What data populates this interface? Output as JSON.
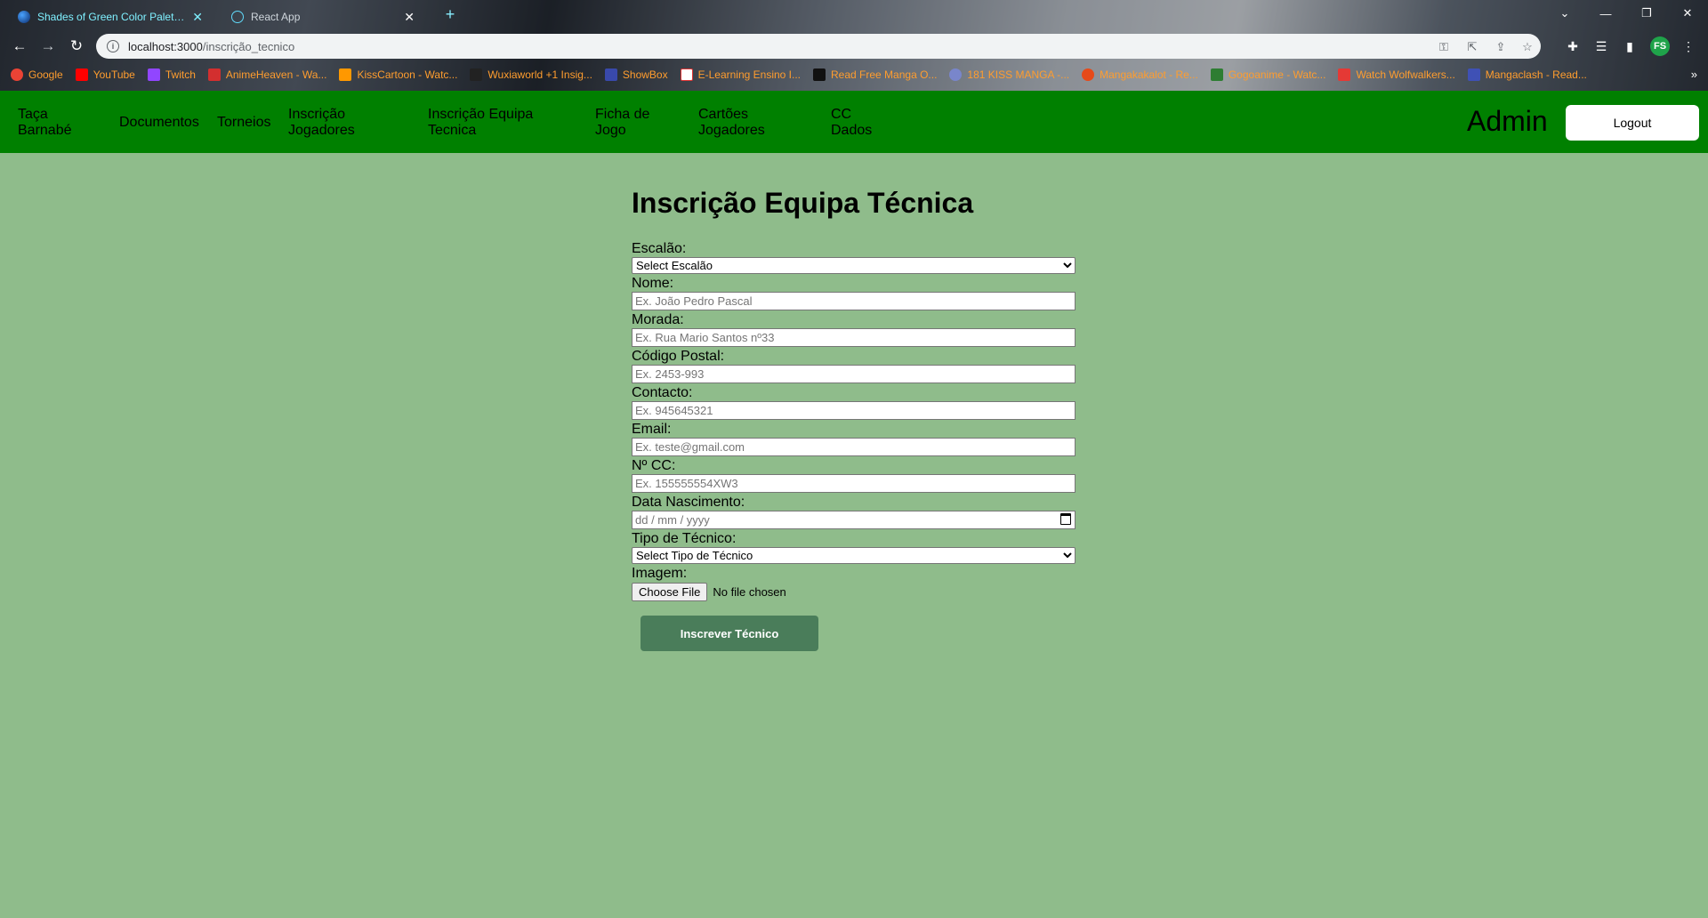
{
  "browser": {
    "tabs": [
      {
        "title": "Shades of Green Color Palettes -",
        "active": true
      },
      {
        "title": "React App",
        "active": false
      }
    ],
    "url_host": "localhost:3000",
    "url_path": "/inscrição_tecnico",
    "profile_initials": "FS",
    "bookmarks": [
      {
        "label": "Google",
        "color": "#ea4335"
      },
      {
        "label": "YouTube",
        "color": "#ff0000"
      },
      {
        "label": "Twitch",
        "color": "#9146ff"
      },
      {
        "label": "AnimeHeaven - Wa...",
        "color": "#d32f2f"
      },
      {
        "label": "KissCartoon - Watc...",
        "color": "#ff9800"
      },
      {
        "label": "Wuxiaworld +1 Insig...",
        "color": "#222222"
      },
      {
        "label": "ShowBox",
        "color": "#3949ab"
      },
      {
        "label": "E-Learning Ensino I...",
        "color": "#ffffff"
      },
      {
        "label": "Read Free Manga O...",
        "color": "#111111"
      },
      {
        "label": "181 KISS MANGA -...",
        "color": "#7986cb"
      },
      {
        "label": "Mangakakalot - Re...",
        "color": "#e64a19"
      },
      {
        "label": "Gogoanime - Watc...",
        "color": "#2e7d32"
      },
      {
        "label": "Watch Wolfwalkers...",
        "color": "#e53935"
      },
      {
        "label": "Mangaclash - Read...",
        "color": "#3f51b5"
      }
    ]
  },
  "nav": {
    "items": [
      {
        "line1": "Taça",
        "line2": "Barnabé"
      },
      {
        "line1": "Documentos",
        "line2": ""
      },
      {
        "line1": "Torneios",
        "line2": ""
      },
      {
        "line1": "Inscrição",
        "line2": "Jogadores"
      },
      {
        "line1": "Inscrição Equipa",
        "line2": "Tecnica"
      },
      {
        "line1": "Ficha de",
        "line2": "Jogo"
      },
      {
        "line1": "Cartões",
        "line2": "Jogadores"
      },
      {
        "line1": "CC",
        "line2": "Dados"
      }
    ],
    "admin_label": "Admin",
    "logout_label": "Logout",
    "bar_color": "#008000"
  },
  "form": {
    "title": "Inscrição Equipa Técnica",
    "escalao": {
      "label": "Escalão:",
      "selected": "Select Escalão"
    },
    "nome": {
      "label": "Nome:",
      "placeholder": "Ex. João Pedro Pascal"
    },
    "morada": {
      "label": "Morada:",
      "placeholder": "Ex. Rua Mario Santos nº33"
    },
    "codigo_postal": {
      "label": "Código Postal:",
      "placeholder": "Ex. 2453-993"
    },
    "contacto": {
      "label": "Contacto:",
      "placeholder": "Ex. 945645321"
    },
    "email": {
      "label": "Email:",
      "placeholder": "Ex. teste@gmail.com"
    },
    "cc": {
      "label": "Nº CC:",
      "placeholder": "Ex. 155555554XW3"
    },
    "data_nascimento": {
      "label": "Data Nascimento:",
      "placeholder": "dd / mm / yyyy"
    },
    "tipo_tecnico": {
      "label": "Tipo de Técnico:",
      "selected": "Select Tipo de Técnico"
    },
    "imagem": {
      "label": "Imagem:",
      "button": "Choose File",
      "status": "No file chosen"
    },
    "submit_label": "Inscrever Técnico"
  },
  "colors": {
    "page_bg": "#8fbc8b",
    "submit_bg": "#4a7d5a"
  }
}
